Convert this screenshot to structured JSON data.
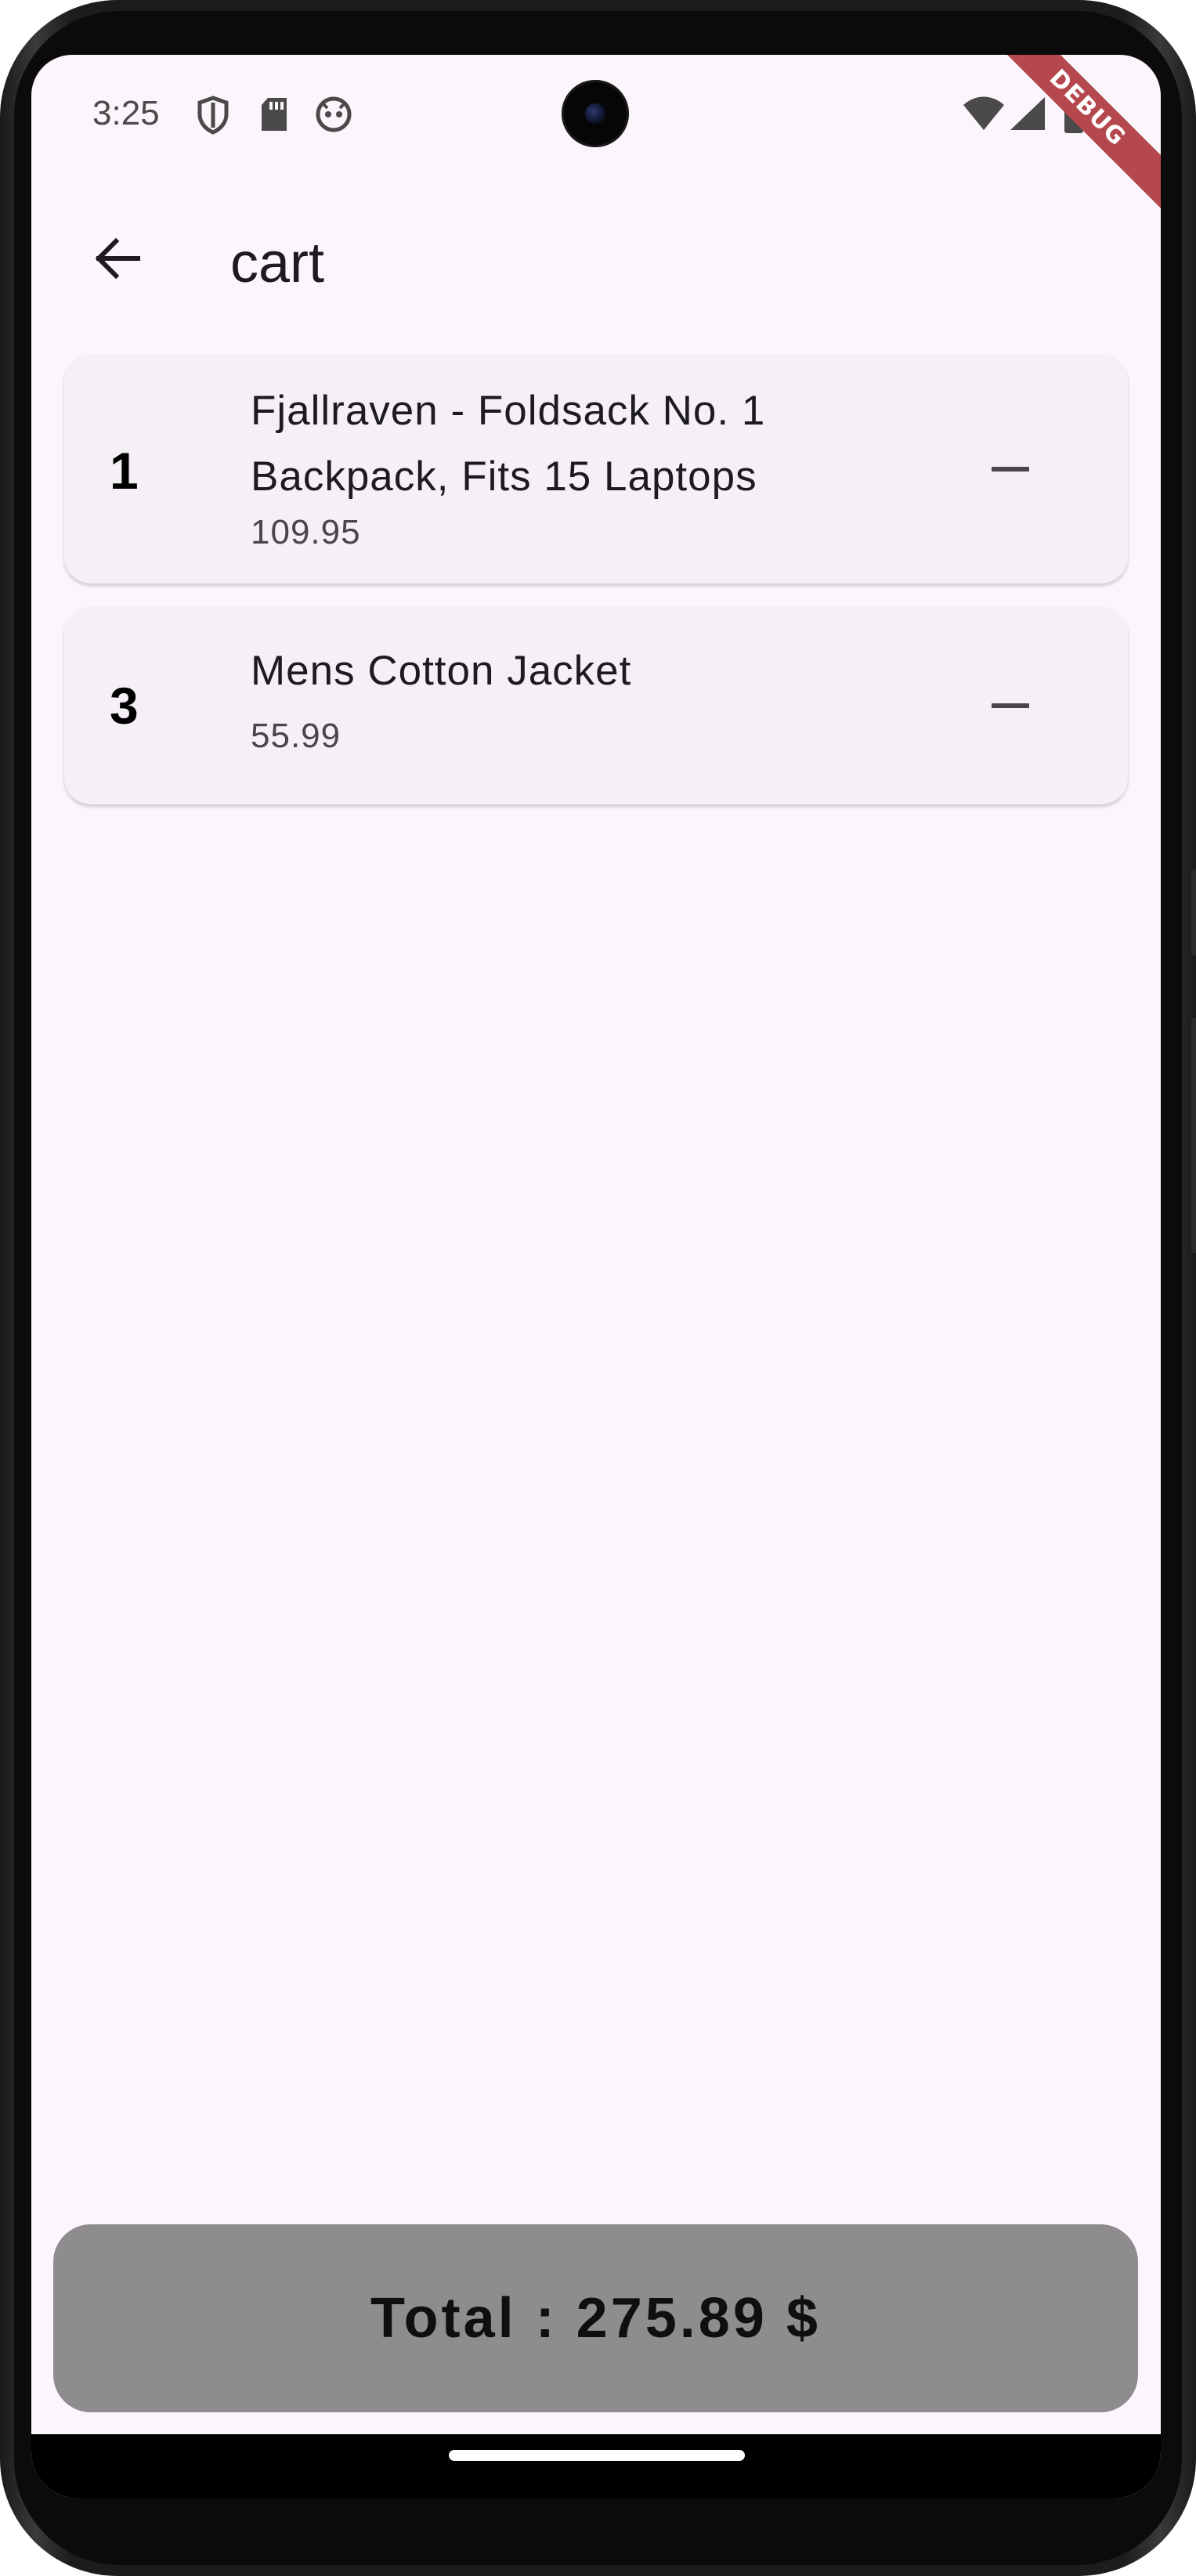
{
  "status_bar": {
    "time": "3:25",
    "debug_banner": "DEBUG",
    "icons": [
      "shield-icon",
      "sd-card-icon",
      "robot-icon",
      "wifi-icon",
      "cellular-signal-icon"
    ]
  },
  "app_bar": {
    "back_icon": "arrow-back-icon",
    "title": "cart"
  },
  "cart": {
    "items": [
      {
        "quantity": "1",
        "title": "Fjallraven - Foldsack No. 1 Backpack, Fits 15 Laptops",
        "price": "109.95",
        "action_icon": "minus-icon"
      },
      {
        "quantity": "3",
        "title": "Mens Cotton Jacket",
        "price": "55.99",
        "action_icon": "minus-icon"
      }
    ]
  },
  "total": {
    "label": "Total : 275.89 $"
  },
  "colors": {
    "background": "#fcf5fc",
    "card": "#f4f0f5",
    "total_button": "#8e8c8f",
    "debug_ribbon": "#b5484e"
  }
}
